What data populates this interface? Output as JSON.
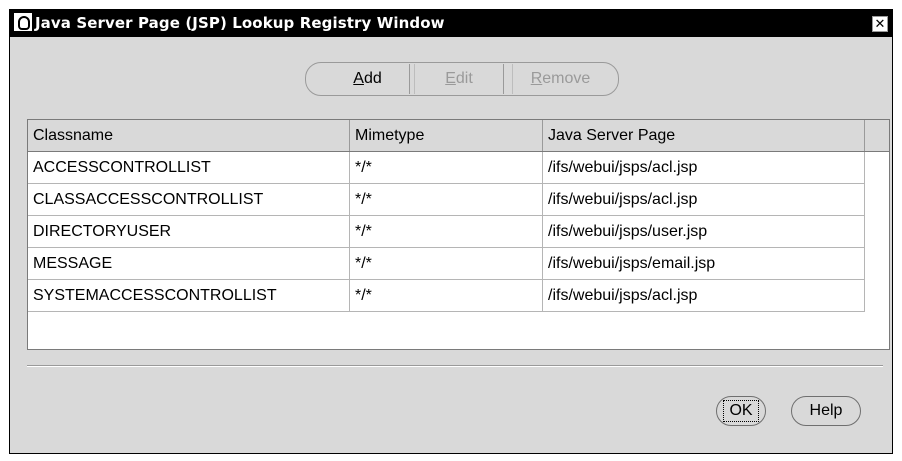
{
  "window": {
    "title": "Java Server Page (JSP) Lookup Registry Window",
    "close_glyph": "✕"
  },
  "toolbar": {
    "add_label": "Add",
    "add_mnemonic": "A",
    "add_rest": "dd",
    "edit_label": "Edit",
    "edit_mnemonic": "E",
    "edit_rest": "dit",
    "remove_label": "Remove",
    "remove_mnemonic": "R",
    "remove_rest": "emove"
  },
  "table": {
    "columns": [
      "Classname",
      "Mimetype",
      "Java Server Page"
    ],
    "rows": [
      [
        "ACCESSCONTROLLIST",
        "*/*",
        "/ifs/webui/jsps/acl.jsp"
      ],
      [
        "CLASSACCESSCONTROLLIST",
        "*/*",
        "/ifs/webui/jsps/acl.jsp"
      ],
      [
        "DIRECTORYUSER",
        "*/*",
        "/ifs/webui/jsps/user.jsp"
      ],
      [
        "MESSAGE",
        "*/*",
        "/ifs/webui/jsps/email.jsp"
      ],
      [
        "SYSTEMACCESSCONTROLLIST",
        "*/*",
        "/ifs/webui/jsps/acl.jsp"
      ]
    ]
  },
  "footer": {
    "ok_label": "OK",
    "help_label": "Help"
  },
  "icons": {
    "app_icon": "oracle-q-icon",
    "close_icon": "close-icon"
  },
  "colors": {
    "titlebar": "#000000",
    "dialog_bg": "#d9d9d9",
    "disabled_text": "#9a9a9a"
  }
}
